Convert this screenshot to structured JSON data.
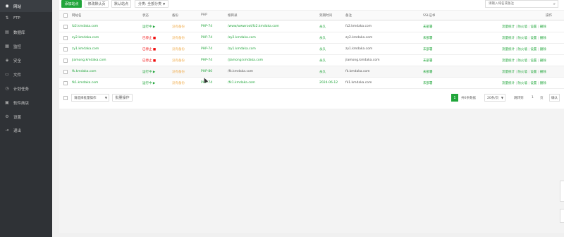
{
  "sidebar": {
    "items": [
      {
        "label": "网站",
        "icon": "globe-icon",
        "glyph": "◉"
      },
      {
        "label": "FTP",
        "icon": "ftp-icon",
        "glyph": "⇅"
      },
      {
        "label": "数据库",
        "icon": "database-icon",
        "glyph": "▤"
      },
      {
        "label": "监控",
        "icon": "monitor-icon",
        "glyph": "▦"
      },
      {
        "label": "安全",
        "icon": "shield-icon",
        "glyph": "◈"
      },
      {
        "label": "文件",
        "icon": "folder-icon",
        "glyph": "▭"
      },
      {
        "label": "计划任务",
        "icon": "clock-icon",
        "glyph": "◷"
      },
      {
        "label": "软件商店",
        "icon": "store-icon",
        "glyph": "▣"
      },
      {
        "label": "设置",
        "icon": "gear-icon",
        "glyph": "⚙"
      },
      {
        "label": "退出",
        "icon": "logout-icon",
        "glyph": "⇥"
      }
    ]
  },
  "toolbar": {
    "add_site": "添加站点",
    "default_page": "修改默认页",
    "default_site": "默认站点",
    "category": "分类: 全部分类",
    "search_placeholder": "请输入域名或备注"
  },
  "table": {
    "headers": [
      "网站名",
      "状态",
      "备份",
      "PHP",
      "根目录",
      "到期时间",
      "备注",
      "SSL证书",
      "操作"
    ],
    "rows": [
      {
        "site": "fz2.kmdaka.com",
        "status": "运行中 ▶",
        "status_color": "#20a53a",
        "backup": "没有备份",
        "php": "PHP-74",
        "root": "/www/wwwroot/fz2.kmdaka.com",
        "expire": "永久",
        "note": "fz2.kmdaka.com",
        "ssl": "未部署",
        "ops": [
          "流量统计",
          "防火墙",
          "设置",
          "删除"
        ]
      },
      {
        "site": "zy2.kmdaka.com",
        "status": "已停止 ■",
        "status_color": "#ef0808",
        "backup": "没有备份",
        "php": "PHP-74",
        "root": "/zy2.kmdaka.com",
        "expire": "永久",
        "note": "zy2.kmdaka.com",
        "ssl": "未部署",
        "ops": [
          "流量统计",
          "防火墙",
          "设置",
          "删除"
        ]
      },
      {
        "site": "zy1.kmdaka.com",
        "status": "已停止 ■",
        "status_color": "#ef0808",
        "backup": "没有备份",
        "php": "PHP-74",
        "root": "/zy1.kmdaka.com",
        "expire": "永久",
        "note": "zy1.kmdaka.com",
        "ssl": "未部署",
        "ops": [
          "流量统计",
          "防火墙",
          "设置",
          "删除"
        ]
      },
      {
        "site": "jiamong.kmdaka.com",
        "status": "已停止 ■",
        "status_color": "#ef0808",
        "backup": "没有备份",
        "php": "PHP-74",
        "root": "/jiamong.kmdaka.com",
        "expire": "永久",
        "note": "jiamong.kmdaka.com",
        "ssl": "未部署",
        "ops": [
          "流量统计",
          "防火墙",
          "设置",
          "删除"
        ]
      },
      {
        "site": "fk.kmdaka.com",
        "status": "运行中 ▶",
        "status_color": "#20a53a",
        "backup": "没有备份",
        "php": "PHP-80",
        "root": "/fk.kmdaka.com",
        "expire": "永久",
        "note": "fk.kmdaka.com",
        "ssl": "未部署",
        "ops": [
          "流量统计",
          "防火墙",
          "设置",
          "删除"
        ]
      },
      {
        "site": "fk1.kmdaka.com",
        "status": "运行中 ▶",
        "status_color": "#20a53a",
        "backup": "没有备份",
        "php": "PHP-74",
        "root": "/fk1.kmdaka.com",
        "expire": "2024-06-12",
        "note": "fk1.kmdaka.com",
        "ssl": "未部署",
        "ops": [
          "流量统计",
          "防火墙",
          "设置",
          "删除"
        ]
      }
    ]
  },
  "footer": {
    "batch_select": "请选择批量操作",
    "batch_button": "批量操作",
    "current_page": "1",
    "total": "共6条数据",
    "per_page": "20条/页",
    "jump_label": "跳转到",
    "jump_value": "1",
    "page_unit": "页",
    "confirm": "确认"
  },
  "colors": {
    "accent": "#20a53a",
    "stopped": "#ef0808",
    "sidebar_bg": "#2f3236"
  }
}
